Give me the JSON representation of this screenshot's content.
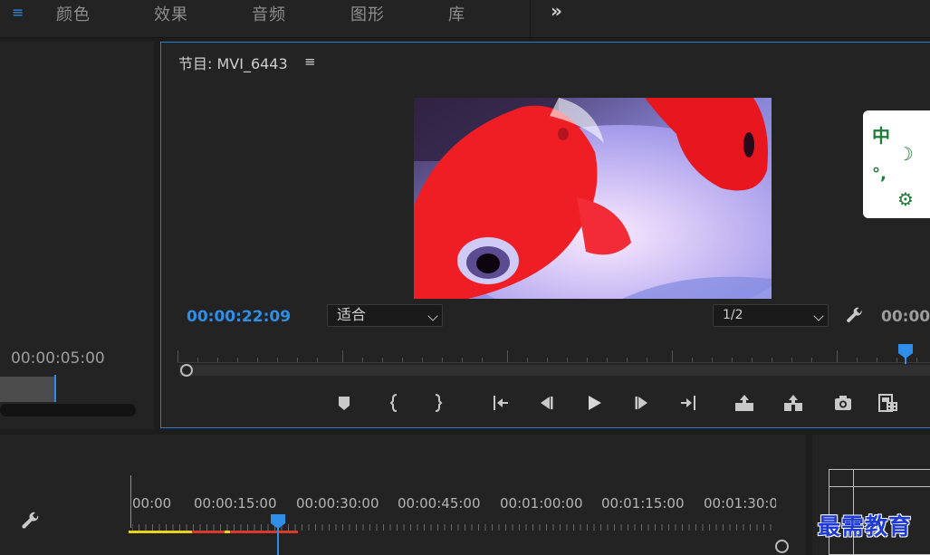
{
  "workspace": {
    "tabs": [
      "颜色",
      "效果",
      "音频",
      "图形",
      "库"
    ],
    "more_glyph": "»"
  },
  "source": {
    "timecode": "00:00:05:00",
    "add_glyph": "+"
  },
  "program": {
    "title": "节目: MVI_6443",
    "menu_glyph": "≡",
    "current_timecode": "00:00:22:09",
    "fit_value": "适合",
    "resolution_value": "1/2",
    "duration_timecode": "00:00"
  },
  "widget": {
    "chars": [
      "中",
      "☽",
      "°,",
      "⚙"
    ]
  },
  "timeline": {
    "timecodes": [
      "00:00",
      "00:00:15:00",
      "00:00:30:00",
      "00:00:45:00",
      "00:01:00:00",
      "00:01:15:00",
      "00:01:30:0("
    ]
  },
  "watermark": "最需教育",
  "colors": {
    "accent_blue": "#2f8ee8",
    "panel": "#232323",
    "workarea_yellow": "#e7d221",
    "render_red": "#d63a2a"
  }
}
